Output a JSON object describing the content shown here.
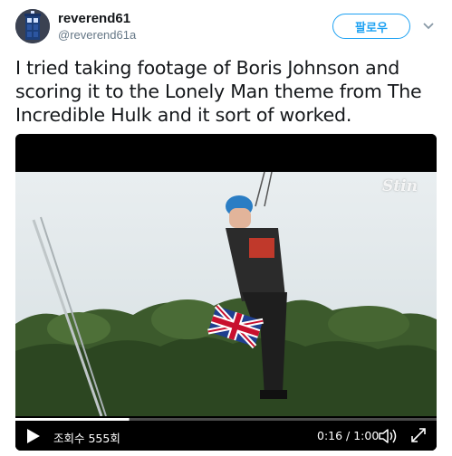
{
  "author": {
    "display_name": "reverend61",
    "handle": "@reverend61a",
    "avatar_icon": "tardis-avatar"
  },
  "follow_label": "팔로우",
  "tweet_text": "I tried taking footage of Boris Johnson and scoring it to the Lonely Man theme from The Incredible Hulk and it sort of worked.",
  "video": {
    "watermark": "Stin",
    "views_label": "조회수 555회",
    "time_label": "0:16 / 1:00",
    "progress": 0.27
  },
  "colors": {
    "accent": "#1da1f2",
    "text": "#14171a",
    "secondary": "#657786"
  }
}
